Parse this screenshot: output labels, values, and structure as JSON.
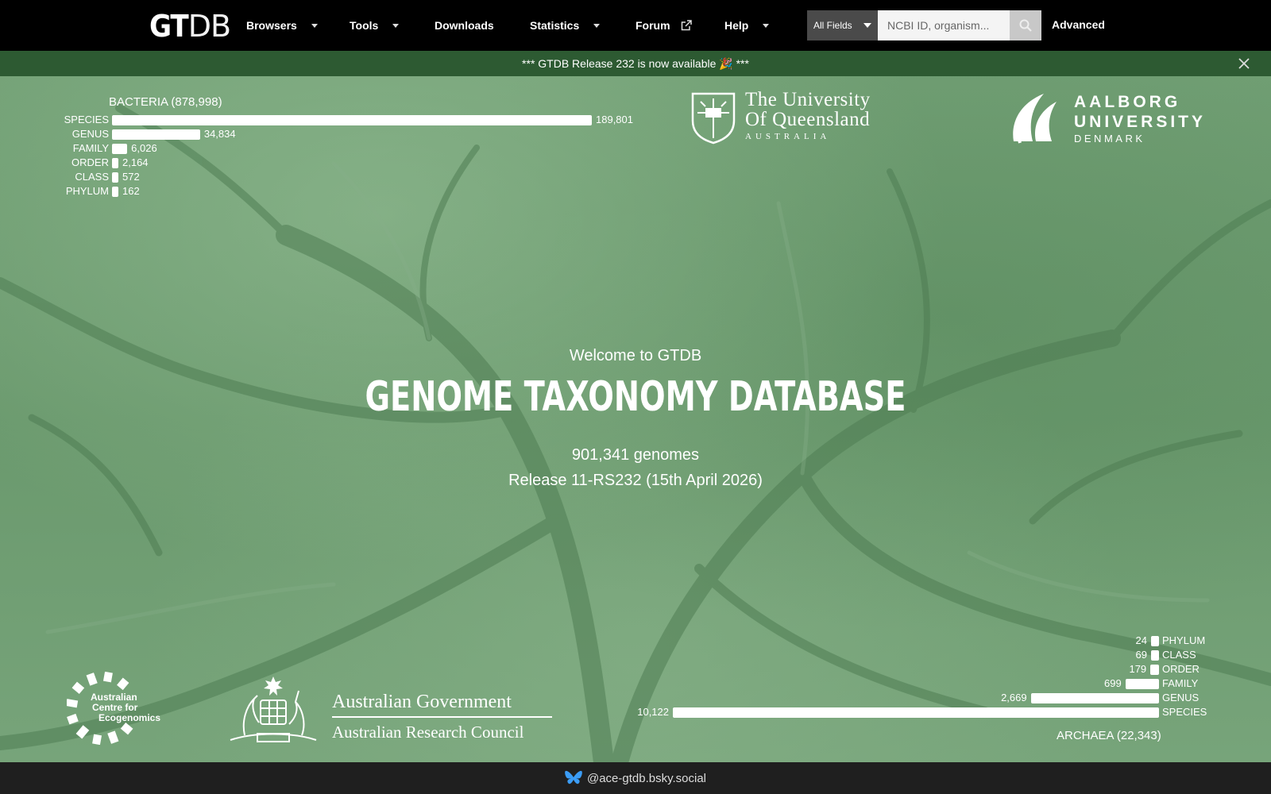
{
  "nav": {
    "logo_bold": "GT",
    "logo_thin": "DB",
    "browsers": "Browsers",
    "tools": "Tools",
    "downloads": "Downloads",
    "statistics": "Statistics",
    "forum": "Forum",
    "help": "Help",
    "field_select": "All Fields",
    "search_placeholder": "NCBI ID, organism...",
    "advanced": "Advanced"
  },
  "banner": {
    "text": "*** GTDB Release 232 is now available 🎉 ***"
  },
  "bacteria": {
    "title": "BACTERIA (878,998)",
    "rows": [
      {
        "label": "SPECIES",
        "value": 189801,
        "display": "189,801"
      },
      {
        "label": "GENUS",
        "value": 34834,
        "display": "34,834"
      },
      {
        "label": "FAMILY",
        "value": 6026,
        "display": "6,026"
      },
      {
        "label": "ORDER",
        "value": 2164,
        "display": "2,164"
      },
      {
        "label": "CLASS",
        "value": 572,
        "display": "572"
      },
      {
        "label": "PHYLUM",
        "value": 162,
        "display": "162"
      }
    ]
  },
  "archaea": {
    "title": "ARCHAEA (22,343)",
    "rows": [
      {
        "label": "PHYLUM",
        "value": 24,
        "display": "24"
      },
      {
        "label": "CLASS",
        "value": 69,
        "display": "69"
      },
      {
        "label": "ORDER",
        "value": 179,
        "display": "179"
      },
      {
        "label": "FAMILY",
        "value": 699,
        "display": "699"
      },
      {
        "label": "GENUS",
        "value": 2669,
        "display": "2,669"
      },
      {
        "label": "SPECIES",
        "value": 10122,
        "display": "10,122"
      }
    ]
  },
  "hero": {
    "welcome": "Welcome to GTDB",
    "title": "GENOME TAXONOMY DATABASE",
    "genomes": "901,341 genomes",
    "release": "Release 11-RS232 (15th April 2026)"
  },
  "logos": {
    "uq_line1": "The University",
    "uq_line2": "Of Queensland",
    "uq_line3": "AUSTRALIA",
    "aau_line1": "AALBORG",
    "aau_line2": "UNIVERSITY",
    "aau_line3": "DENMARK",
    "ace_line1": "Australian",
    "ace_line2": "Centre for",
    "ace_line3": "Ecogenomics",
    "gov_line1": "Australian Government",
    "gov_line2": "Australian Research Council"
  },
  "footer": {
    "handle": "@ace-gtdb.bsky.social"
  },
  "colors": {
    "navbar": "#000000",
    "banner": "#2d5a32",
    "hero": "#6b9a6f",
    "footer": "#1f1f1f"
  }
}
